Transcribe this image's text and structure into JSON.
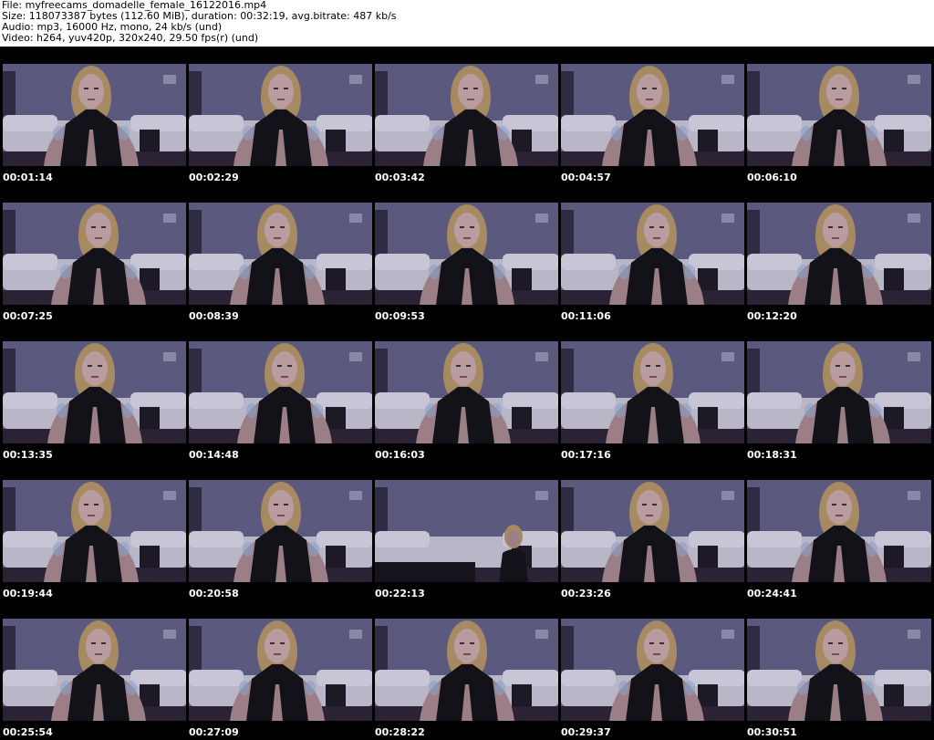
{
  "header": {
    "file": "File: myfreecams_domadelle_female_16122016.mp4",
    "size": "Size: 118073387 bytes (112.60 MiB), duration: 00:32:19, avg.bitrate: 487 kb/s",
    "audio": "Audio: mp3, 16000 Hz, mono, 24 kb/s (und)",
    "video": "Video: h264, yuv420p, 320x240, 29.50 fps(r) (und)"
  },
  "thumbnails": [
    {
      "timestamp": "00:01:14"
    },
    {
      "timestamp": "00:02:29"
    },
    {
      "timestamp": "00:03:42"
    },
    {
      "timestamp": "00:04:57"
    },
    {
      "timestamp": "00:06:10"
    },
    {
      "timestamp": "00:07:25"
    },
    {
      "timestamp": "00:08:39"
    },
    {
      "timestamp": "00:09:53"
    },
    {
      "timestamp": "00:11:06"
    },
    {
      "timestamp": "00:12:20"
    },
    {
      "timestamp": "00:13:35"
    },
    {
      "timestamp": "00:14:48"
    },
    {
      "timestamp": "00:16:03"
    },
    {
      "timestamp": "00:17:16"
    },
    {
      "timestamp": "00:18:31"
    },
    {
      "timestamp": "00:19:44"
    },
    {
      "timestamp": "00:20:58"
    },
    {
      "timestamp": "00:22:13"
    },
    {
      "timestamp": "00:23:26"
    },
    {
      "timestamp": "00:24:41"
    },
    {
      "timestamp": "00:25:54"
    },
    {
      "timestamp": "00:27:09"
    },
    {
      "timestamp": "00:28:22"
    },
    {
      "timestamp": "00:29:37"
    },
    {
      "timestamp": "00:30:51"
    }
  ],
  "colors": {
    "background": "#000000",
    "wall": "#5b5a7e",
    "floor": "#2b2236",
    "couch": "#b9b6c8",
    "hair": "#a88a62",
    "skin": "#9c7f86",
    "outfit": "#141219",
    "timestamp_text": "#ffffff"
  }
}
